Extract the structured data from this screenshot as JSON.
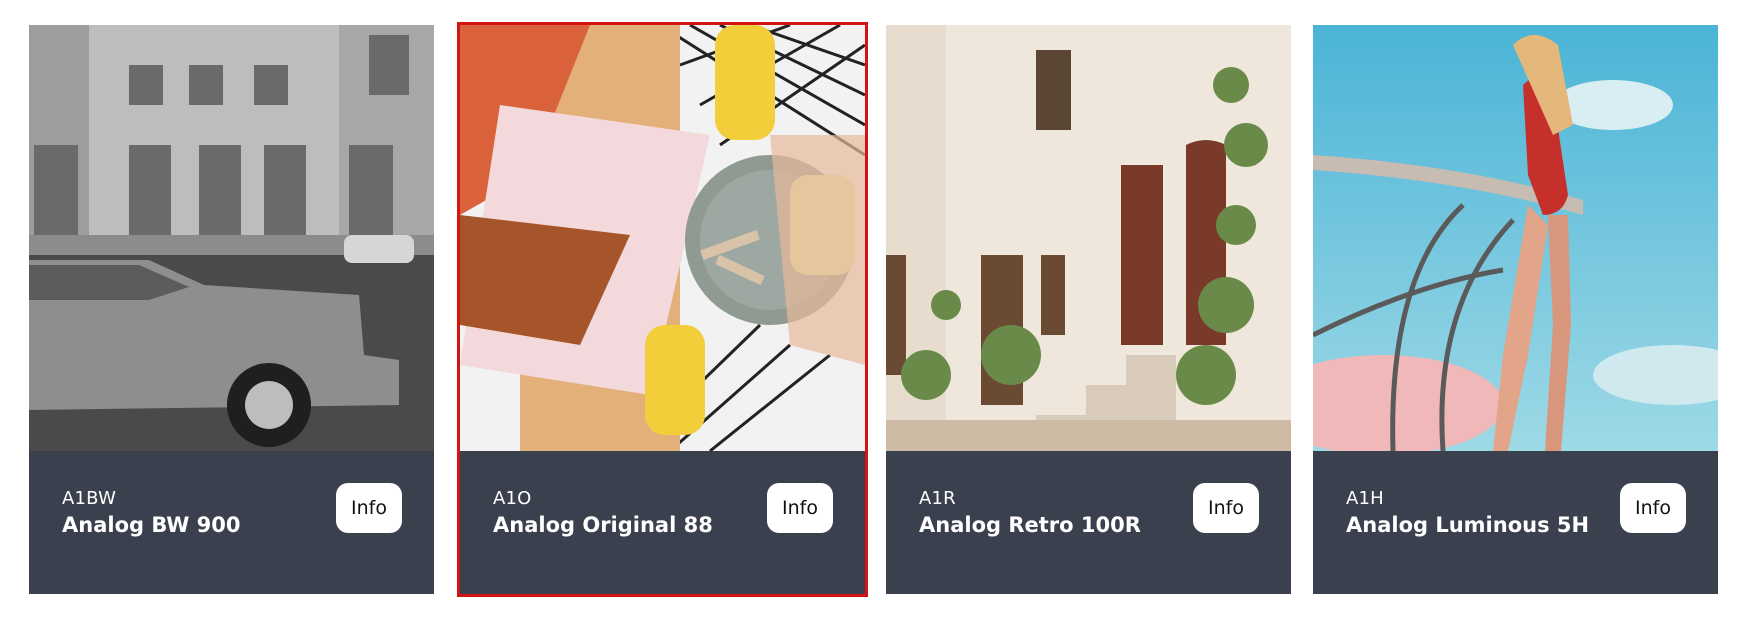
{
  "cards": [
    {
      "code": "A1BW",
      "name": "Analog BW 900",
      "info_label": "Info",
      "selected": false
    },
    {
      "code": "A1O",
      "name": "Analog Original 88",
      "info_label": "Info",
      "selected": true
    },
    {
      "code": "A1R",
      "name": "Analog Retro 100R",
      "info_label": "Info",
      "selected": false
    },
    {
      "code": "A1H",
      "name": "Analog Luminous 5H",
      "info_label": "Info",
      "selected": false
    }
  ],
  "colors": {
    "footer_bg": "#3b404e",
    "selection_outline": "#d31414",
    "button_bg": "#ffffff"
  }
}
